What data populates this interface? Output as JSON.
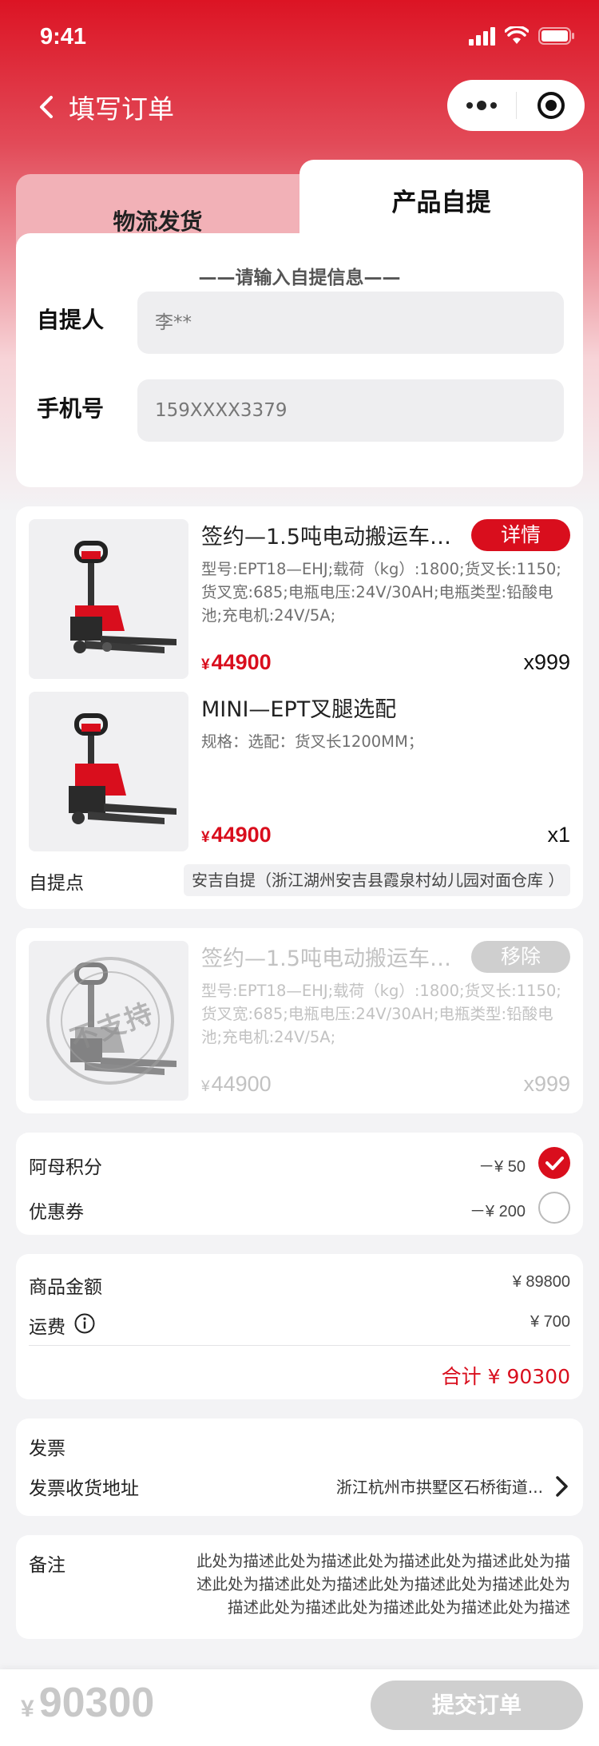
{
  "status_bar": {
    "time": "9:41"
  },
  "nav": {
    "title": "填写订单"
  },
  "tabs": [
    {
      "label": "物流发货",
      "active": false
    },
    {
      "label": "产品自提",
      "active": true
    }
  ],
  "pickup_form": {
    "hint": "——请输入自提信息——",
    "name_label": "自提人",
    "name_value": "李**",
    "phone_label": "手机号",
    "phone_value": "159XXXX3379"
  },
  "products": [
    {
      "title": "签约—1.5吨电动搬运车…",
      "spec": "型号:EPT18—EHJ;载荷（kg）:1800;货叉长:1150;货叉宽:685;电瓶电压:24V/30AH;电瓶类型:铅酸电池;充电机:24V/5A;",
      "currency": "¥",
      "price": "44900",
      "qty": "x999",
      "action": "详情"
    },
    {
      "title": "MINI—EPT叉腿选配",
      "spec": "规格：选配：货叉长1200MM；",
      "currency": "¥",
      "price": "44900",
      "qty": "x1"
    }
  ],
  "pickup_point": {
    "label": "自提点",
    "value": "安吉自提（浙江湖州安吉县霞泉村幼儿园对面仓库 ）"
  },
  "unsupported_product": {
    "title": "签约—1.5吨电动搬运车…",
    "spec": "型号:EPT18—EHJ;载荷（kg）:1800;货叉长:1150;货叉宽:685;电瓶电压:24V/30AH;电瓶类型:铅酸电池;充电机:24V/5A;",
    "currency": "¥",
    "price": "44900",
    "qty": "x999",
    "action": "移除",
    "stamp": "不支持"
  },
  "discounts": [
    {
      "label": "阿母积分",
      "value": "－¥ 50",
      "checked": true
    },
    {
      "label": "优惠券",
      "value": "－¥ 200",
      "checked": false
    }
  ],
  "summary": {
    "goods_label": "商品金额",
    "goods_value": "¥ 89800",
    "shipping_label": "运费",
    "shipping_value": "¥ 700",
    "total": "合计 ¥ 90300"
  },
  "invoice": {
    "title": "发票",
    "address_label": "发票收货地址",
    "address_value": "浙江杭州市拱墅区石桥街道..."
  },
  "remark": {
    "label": "备注",
    "text": "此处为描述此处为描述此处为描述此处为描述此处为描述此处为描述此处为描述此处为描述此处为描述此处为描述此处为描述此处为描述此处为描述此处为描述"
  },
  "bottom": {
    "currency": "¥",
    "total": "90300",
    "submit_label": "提交订单"
  },
  "colors": {
    "brand_red": "#d90e1d",
    "disabled_gray": "#cfcfcf"
  }
}
